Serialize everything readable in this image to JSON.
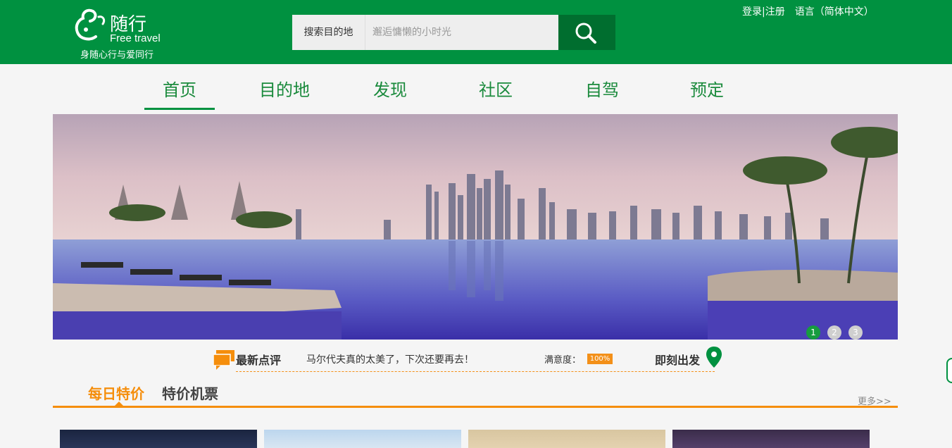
{
  "header": {
    "logo_name": "随行",
    "logo_en": "Free travel",
    "slogan": "身随心行与爱同行",
    "search_label": "搜索目的地",
    "search_placeholder": "邂逅慵懒的小时光",
    "login": "登录",
    "register": "|注册",
    "language": "语言（简体中文）"
  },
  "nav": {
    "items": [
      {
        "label": "首页"
      },
      {
        "label": "目的地"
      },
      {
        "label": "发现"
      },
      {
        "label": "社区"
      },
      {
        "label": "自驾"
      },
      {
        "label": "预定"
      }
    ]
  },
  "banner": {
    "dots": [
      "1",
      "2",
      "3"
    ],
    "active_index": 1
  },
  "reviews": {
    "title": "最新点评",
    "text": "马尔代夫真的太美了，下次还要再去！",
    "satisfaction_label": "满意度：",
    "satisfaction_value": "100%",
    "go_label": "即刻出发"
  },
  "deals": {
    "tab_active": "每日特价",
    "tab_other": "特价机票",
    "more": "更多>>"
  },
  "colors": {
    "brand_green": "#009140",
    "accent_orange": "#f58e0c"
  }
}
